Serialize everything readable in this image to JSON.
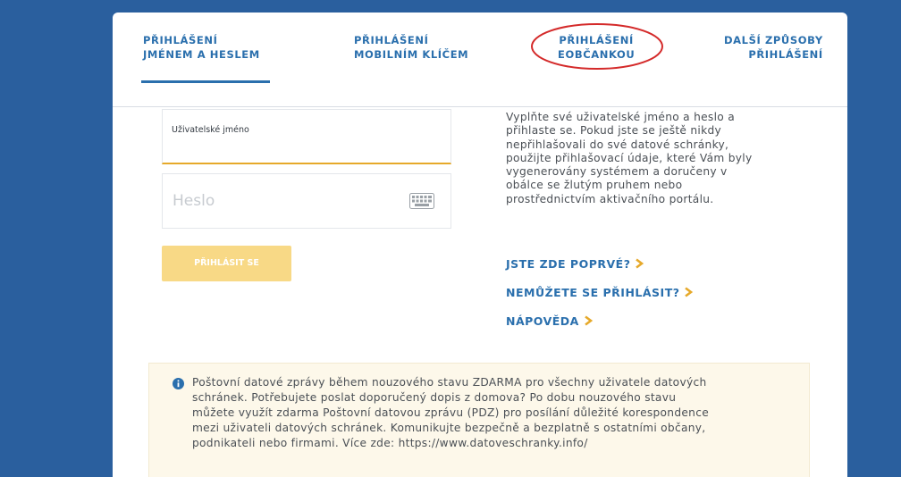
{
  "tabs": [
    {
      "line1": "PŘIHLÁŠENÍ",
      "line2": "JMÉNEM A HESLEM",
      "active": true
    },
    {
      "line1": "PŘIHLÁŠENÍ",
      "line2": "MOBILNÍM KLÍČEM",
      "active": false
    },
    {
      "line1": "PŘIHLÁŠENÍ",
      "line2": "eOBČANKOU",
      "active": false
    },
    {
      "line1": "DALŠÍ ZPŮSOBY",
      "line2": "PŘIHLÁŠENÍ",
      "active": false
    }
  ],
  "form": {
    "username_label": "Uživatelské jméno",
    "username_value": "",
    "password_placeholder": "Heslo",
    "login_button": "PŘIHLÁSIT SE"
  },
  "instructions": [
    "Vyplňte své uživatelské jméno a heslo a",
    "přihlaste se. Pokud jste se ještě nikdy",
    "nepřihlašovali do své datové schránky,",
    "použijte přihlašovací údaje, které Vám byly",
    "vygenerovány systémem a doručeny v",
    "obálce se žlutým pruhem nebo",
    "prostřednictvím aktivačního portálu."
  ],
  "links": {
    "first_time": "JSTE ZDE POPRVÉ?",
    "cannot_login": "NEMŮŽETE SE PŘIHLÁSIT?",
    "help": "NÁPOVĚDA"
  },
  "notice": [
    "Poštovní datové zprávy během nouzového stavu ZDARMA pro všechny uživatele datových",
    "schránek. Potřebujete poslat doporučený dopis z domova? Po dobu nouzového stavu",
    "můžete využít zdarma Poštovní datovou zprávu (PDZ) pro posílání důležité korespondence",
    "mezi uživateli datových schránek. Komunikujte bezpečně a bezplatně s ostatními občany,",
    "podnikateli nebo firmami. Více zde: https://www.datoveschranky.info/"
  ],
  "colors": {
    "background": "#2a5f9e",
    "accent_blue": "#2a6fad",
    "accent_orange": "#e6a92a",
    "button_disabled": "#f8d986",
    "highlight_circle": "#d42a2a",
    "notice_background": "#fdf8ea"
  },
  "icons": {
    "keyboard": "keyboard-icon",
    "chevron": "chevron-right-icon",
    "notice": "info-icon"
  }
}
